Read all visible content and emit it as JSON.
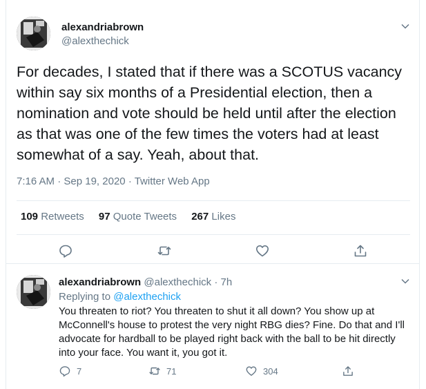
{
  "main_tweet": {
    "author": {
      "name": "alexandriabrown",
      "handle": "@alexthechick",
      "avatar_icon": "profile-photo"
    },
    "text": "For decades, I stated that if there was a SCOTUS vacancy within say six months of a Presidential election, then a nomination and vote should be held until after the election as that was one of the few times the voters had at least somewhat of a say.  Yeah, about that.",
    "time": "7:16 AM",
    "sep1": "·",
    "date": "Sep 19, 2020",
    "sep2": "·",
    "source": "Twitter Web App",
    "stats": {
      "retweets_count": "109",
      "retweets_label": "Retweets",
      "quote_count": "97",
      "quote_label": "Quote Tweets",
      "likes_count": "267",
      "likes_label": "Likes"
    },
    "actions": [
      "reply-icon",
      "retweet-icon",
      "like-icon",
      "share-icon"
    ]
  },
  "reply_tweet": {
    "author": {
      "name": "alexandriabrown",
      "handle": "@alexthechick",
      "dot": "·",
      "time": "7h"
    },
    "replying_label": "Replying to",
    "replying_to": "@alexthechick",
    "text": "You threaten to riot?  You threaten to shut it all down?  You show up at McConnell's house to protest the very night RBG dies?  Fine. Do that and I'll advocate for hardball to be played right back with the ball to be hit directly into your face.  You want it, you got it.",
    "counts": {
      "replies": "7",
      "retweets": "71",
      "likes": "304"
    }
  },
  "colors": {
    "text": "#14171a",
    "secondary": "#657786",
    "link": "#1da1f2",
    "border": "#e6ecf0"
  }
}
